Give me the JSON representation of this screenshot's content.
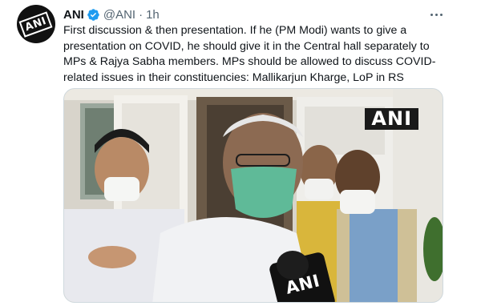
{
  "author": {
    "name": "ANI",
    "handle": "@ANI",
    "separator": "·",
    "time": "1h",
    "avatar_text": "ANI",
    "verified_color": "#1d9bf0"
  },
  "tweet": {
    "text": "First discussion & then presentation. If he (PM Modi) wants to give a\npresentation on COVID, he should give it in the Central hall separately to\nMPs & Rajya Sabha members. MPs should be allowed to discuss COVID-\nrelated issues in their constituencies: Mallikarjun Kharge, LoP in RS"
  },
  "media": {
    "watermark": "ANI",
    "mic_label": "ANI"
  },
  "icons": {
    "verified": "verified-badge-icon",
    "more": "more-options-icon"
  }
}
